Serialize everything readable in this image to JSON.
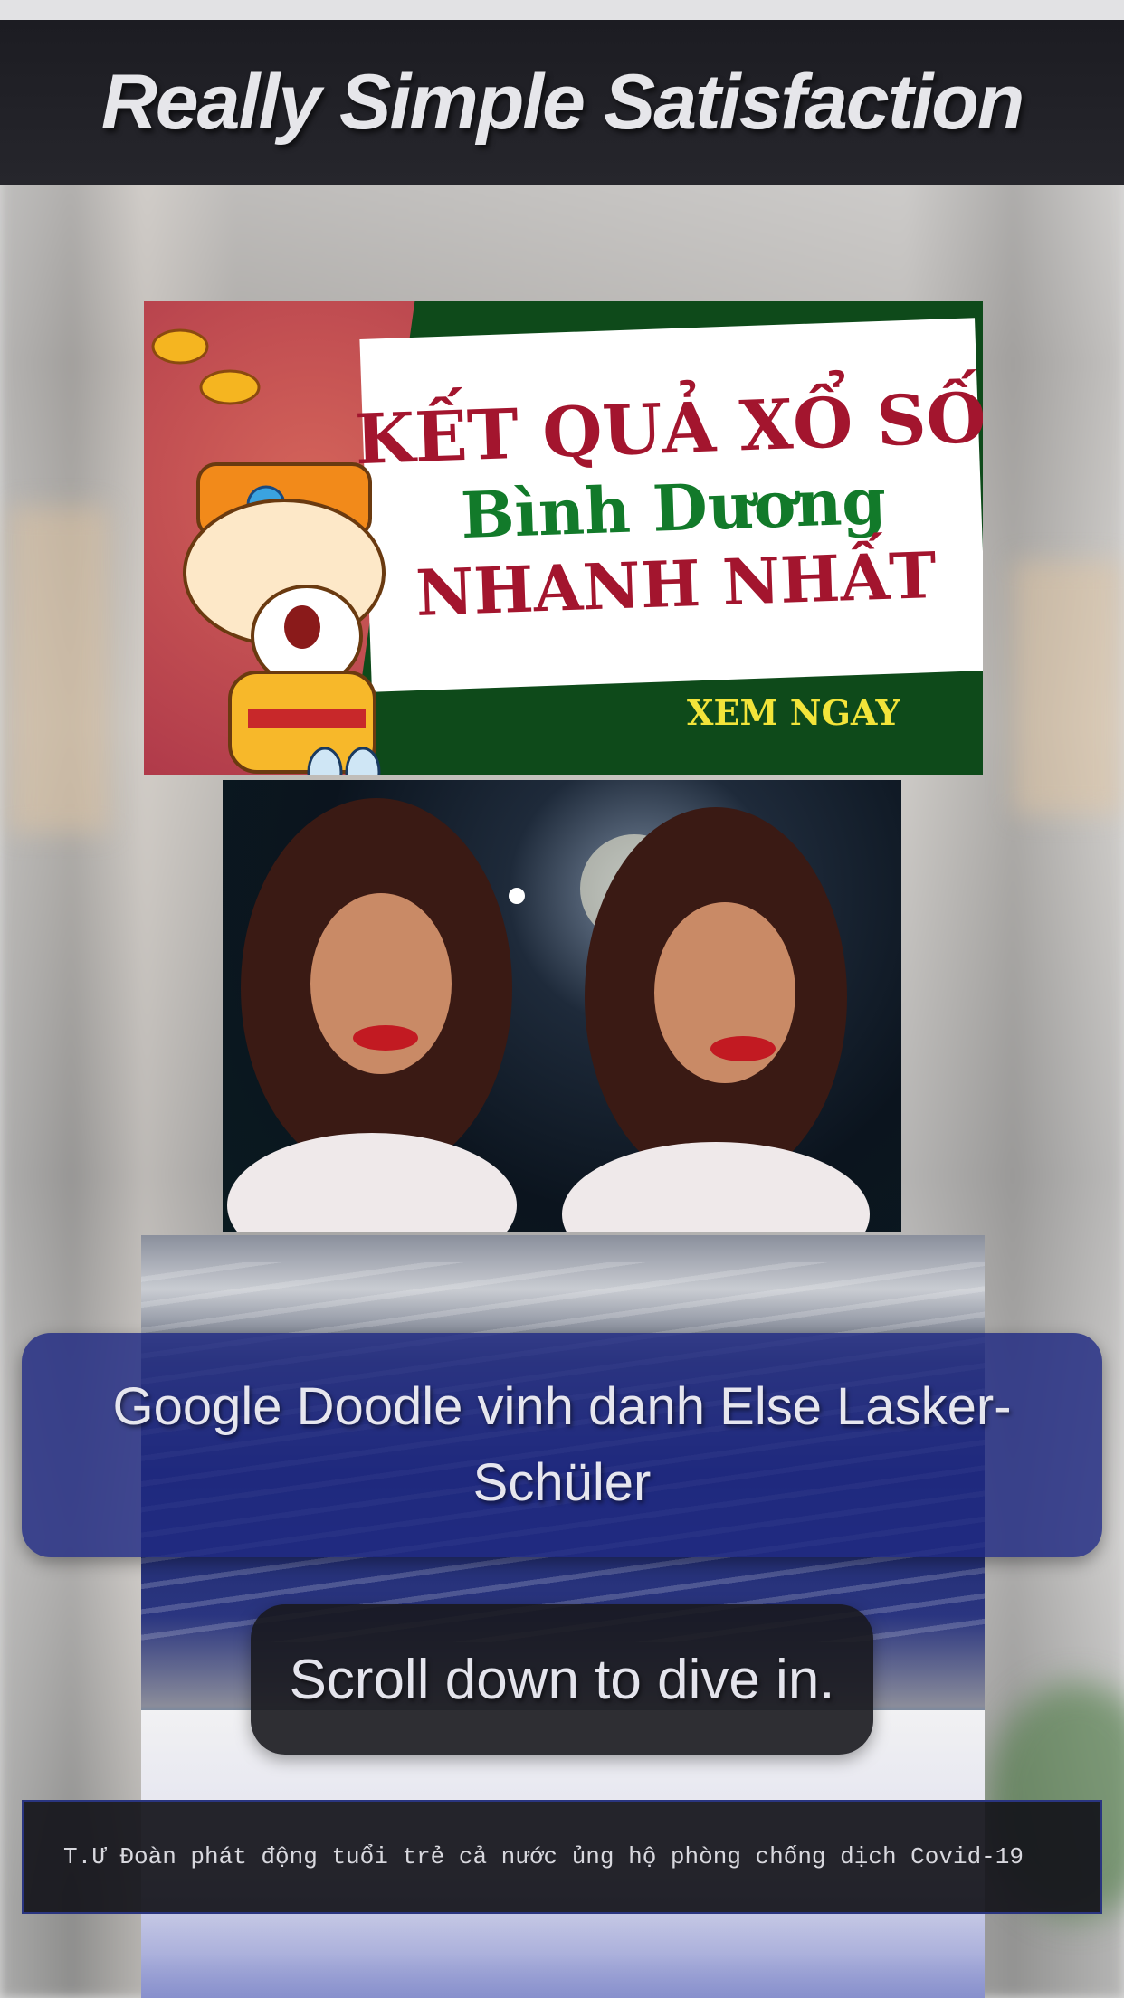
{
  "header": {
    "title": "Really Simple Satisfaction"
  },
  "banner": {
    "line1": "KẾT QUẢ XỔ SỐ",
    "line2": "Bình Dương",
    "line3": "NHANH NHẤT",
    "cta": "XEM NGAY"
  },
  "headline": {
    "text": "Google Doodle vinh danh Else Lasker-Schüler"
  },
  "scroll_hint": {
    "text": "Scroll down to dive in."
  },
  "ticker": {
    "text": "T.Ư Đoàn phát động tuổi trẻ cả nước ủng hộ phòng chống dịch Covid-19"
  },
  "colors": {
    "header_bg": "#1c1c22",
    "headline_bg": "#202a82",
    "pill_bg": "#18181e",
    "banner_red": "#a3152e",
    "banner_green": "#127a2a",
    "banner_cta": "#f2e43a"
  }
}
